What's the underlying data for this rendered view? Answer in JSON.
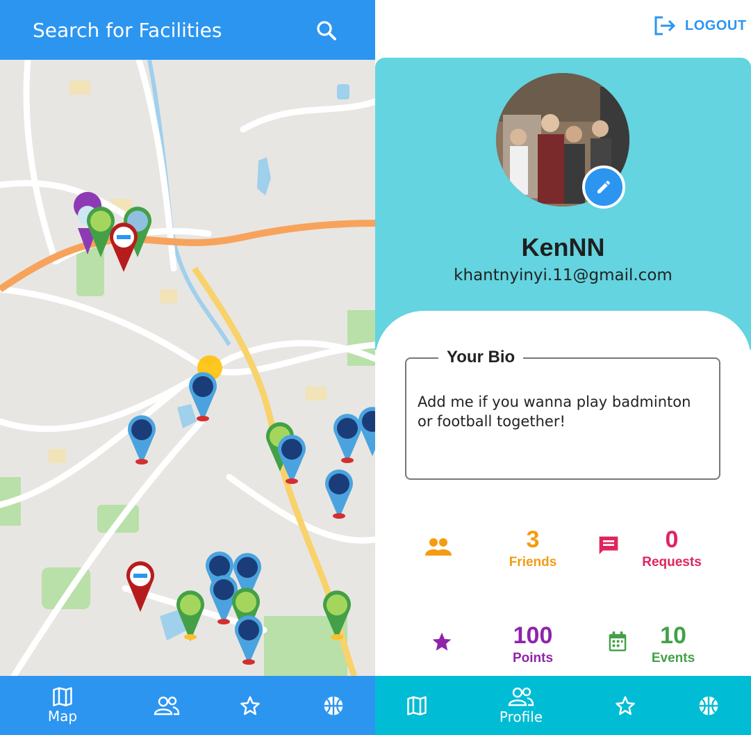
{
  "map_screen": {
    "search_bar": {
      "title": "Search for Facilities"
    },
    "nav": {
      "map_label": "Map"
    }
  },
  "profile_screen": {
    "logout_label": "LOGOUT",
    "username": "KenNN",
    "email": "khantnyinyi.11@gmail.com",
    "bio": {
      "label": "Your Bio",
      "text": "Add me if you wanna play badminton or football together!"
    },
    "stats": {
      "friends": {
        "value": "3",
        "label": "Friends"
      },
      "requests": {
        "value": "0",
        "label": "Requests"
      },
      "points": {
        "value": "100",
        "label": "Points"
      },
      "events": {
        "value": "10",
        "label": "Events"
      }
    },
    "nav": {
      "profile_label": "Profile"
    }
  },
  "colors": {
    "primary_blue": "#2c95f0",
    "cyan_nav": "#00bcd4",
    "header_cyan": "#63d4e0",
    "friends_orange": "#f39c12",
    "requests_pink": "#e0245e",
    "points_purple": "#8e24aa",
    "events_green": "#43a047"
  },
  "icons": [
    "search-icon",
    "map-icon",
    "friends-icon",
    "star-icon",
    "basketball-icon",
    "logout-icon",
    "edit-icon",
    "message-icon",
    "calendar-icon"
  ]
}
